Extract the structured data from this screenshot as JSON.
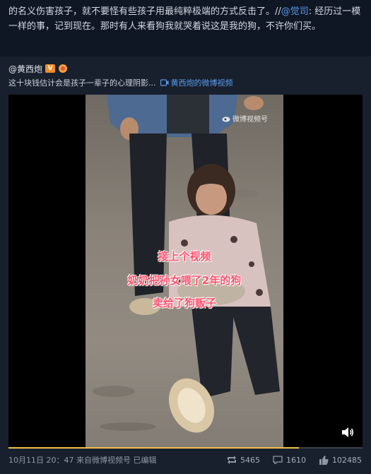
{
  "post": {
    "text_part1": "的名义伤害孩子，就不要怪有些孩子用最纯粹极端的方式反击了。//",
    "mention": "@觉司",
    "text_part2": ": 经历过一模一样的事，记到现在。那时有人来看狗我就哭着说这是我的狗，不许你们买。"
  },
  "repost": {
    "author": "@黄西炮",
    "verified_badge": "V",
    "description": "这十块钱估计会是孩子一辈子的心理阴影...",
    "video_link_label": "黄西炮的微博视频"
  },
  "video": {
    "watermark": "微博视频号",
    "caption_lines": [
      "接上个视频",
      "奶奶把孙女喂了2年的狗",
      "卖给了狗贩子"
    ],
    "progress": 0.82
  },
  "footer": {
    "timestamp": "10月11日 20：47 来自微博视频号  已编辑",
    "reposts": "5465",
    "comments": "1610",
    "likes": "102485"
  },
  "colors": {
    "link": "#5b9bf0",
    "accent_orange": "#f28c28",
    "caption": "#ff4f6a",
    "progress": "#f0c048"
  }
}
